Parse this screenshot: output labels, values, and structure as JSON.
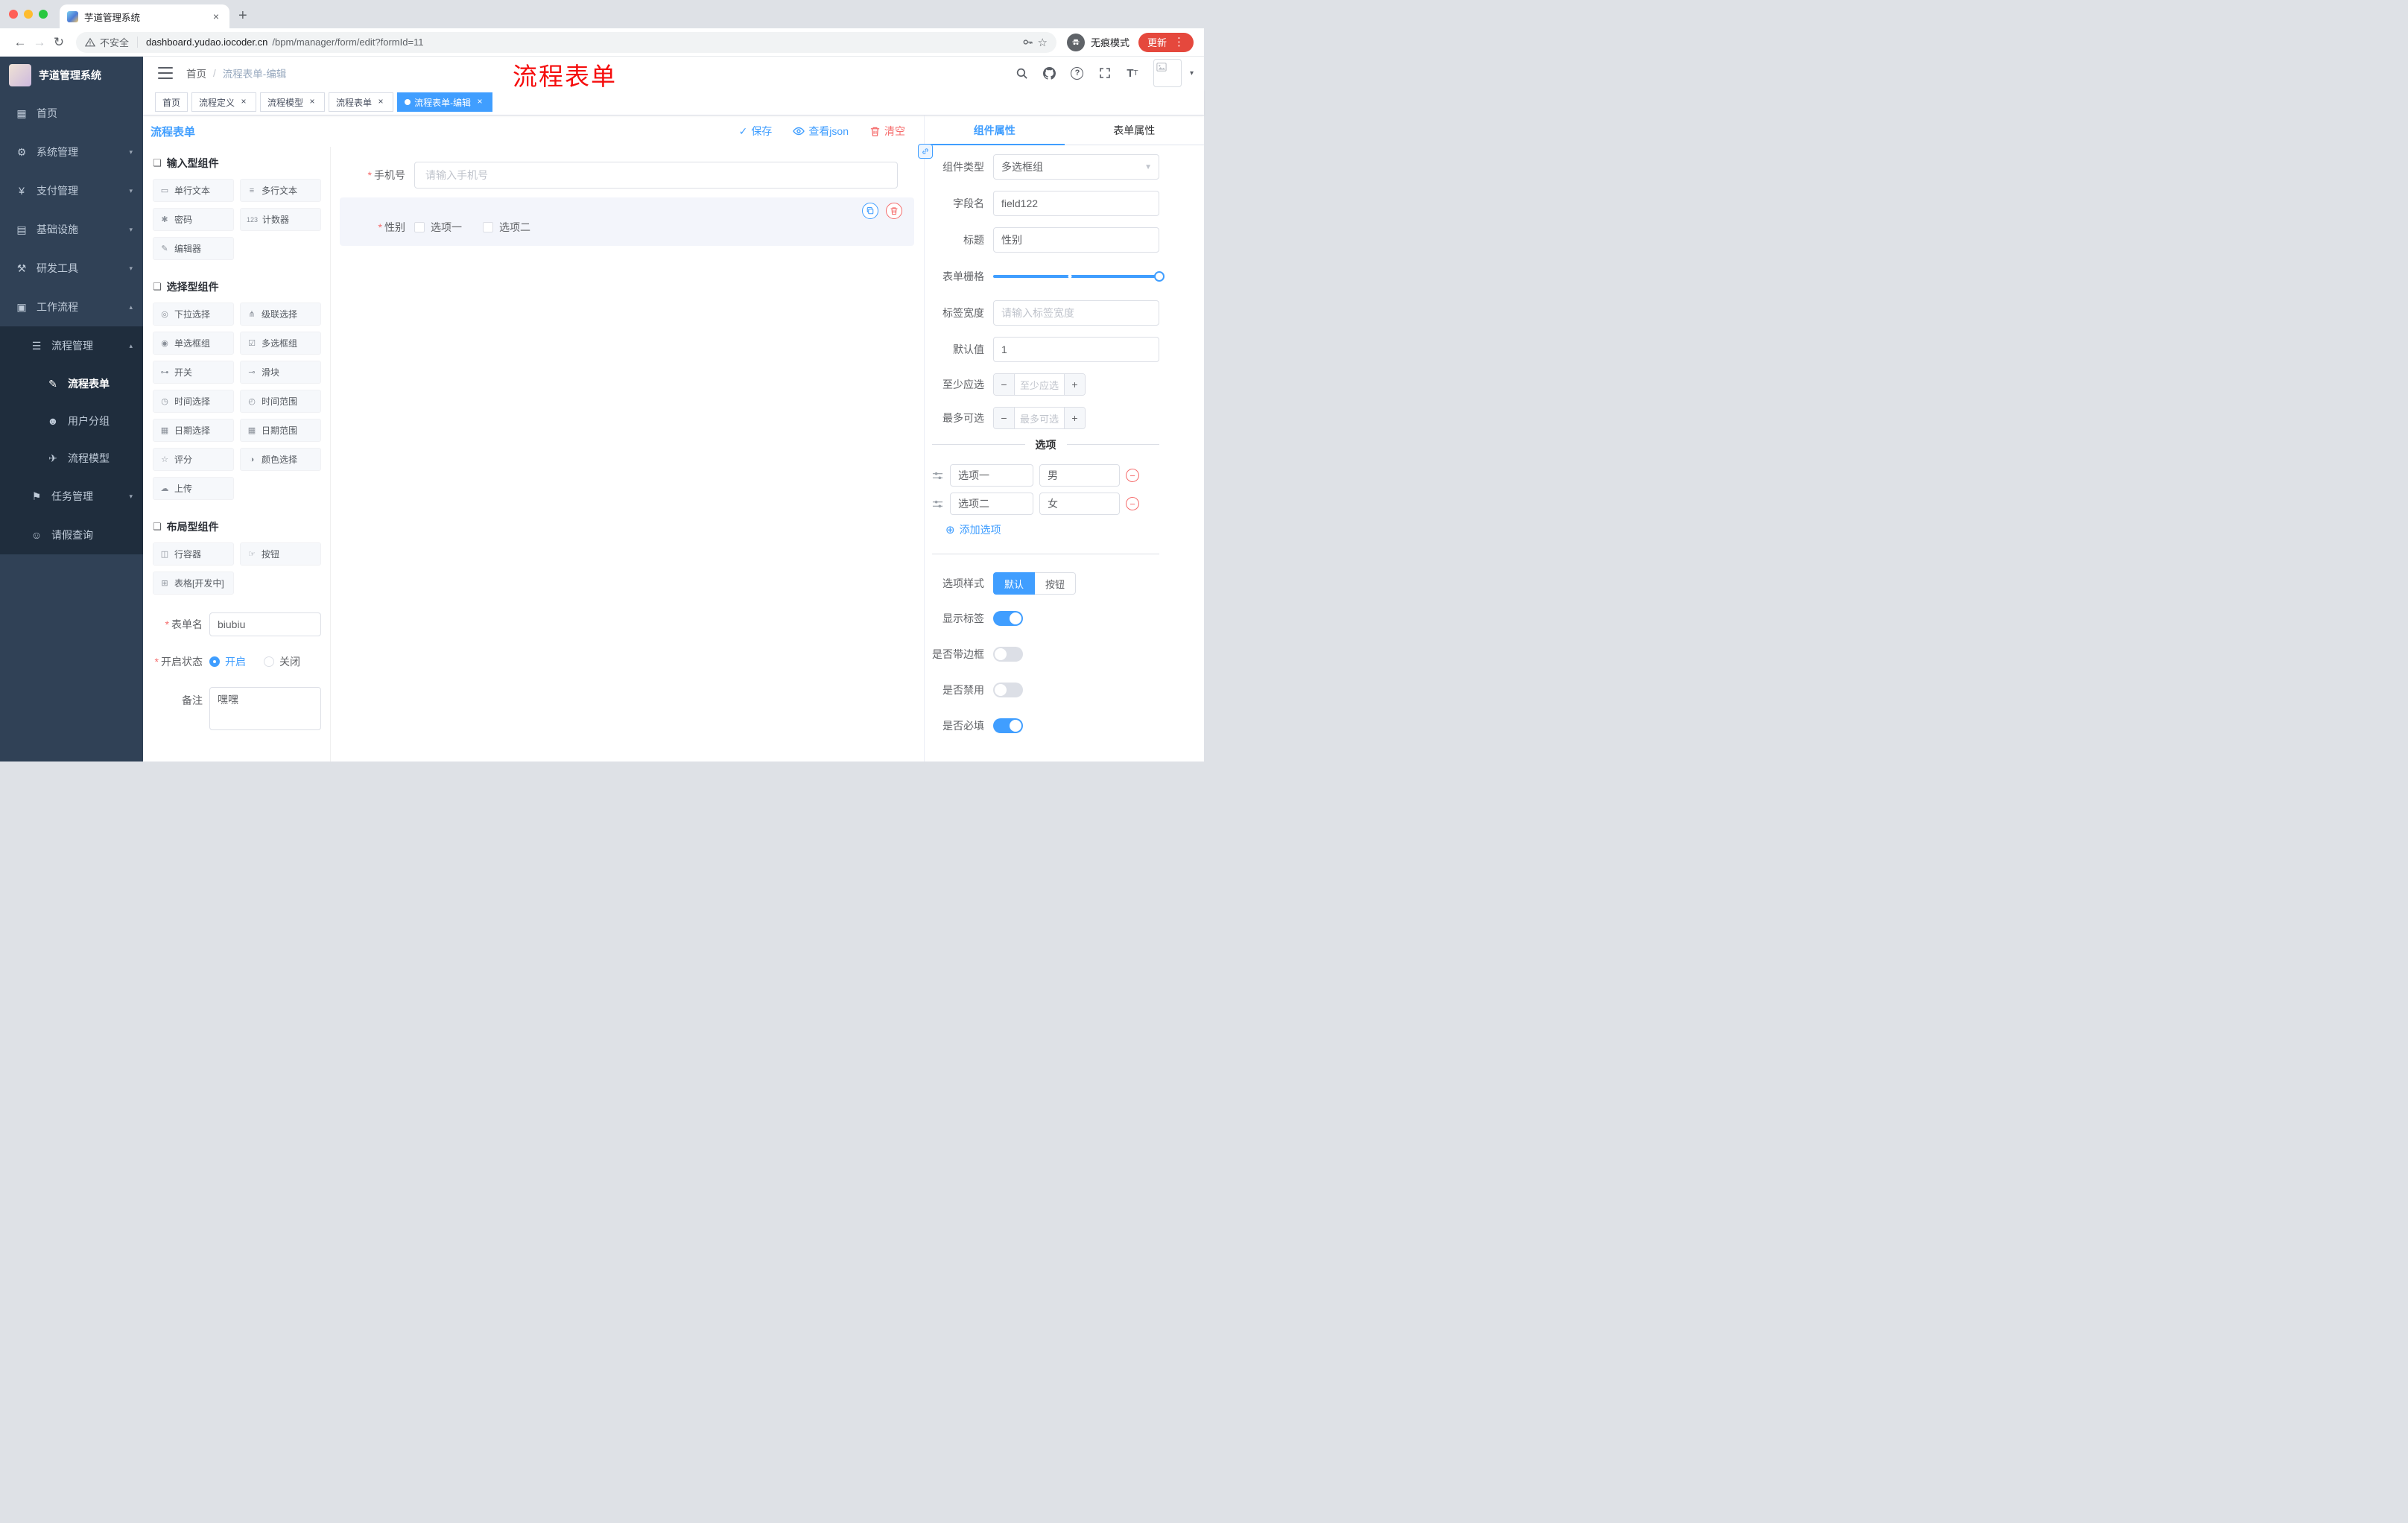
{
  "colors": {
    "primary": "#409eff",
    "danger": "#f56c6c",
    "sidebar_bg": "#304156",
    "submenu_bg": "#1f2d3d",
    "update_chip": "#e5483d",
    "annotation_red": "#f50d0d"
  },
  "browser": {
    "tab_title": "芋道管理系统",
    "security_label": "不安全",
    "url_host": "dashboard.yudao.iocoder.cn",
    "url_path": "/bpm/manager/form/edit?formId=11",
    "incognito_label": "无痕模式",
    "update_label": "更新"
  },
  "annotation": "流程表单",
  "sidebar": {
    "logo_title": "芋道管理系统",
    "menu": [
      {
        "label": "首页",
        "icon": "▦"
      },
      {
        "label": "系统管理",
        "icon": "⚙"
      },
      {
        "label": "支付管理",
        "icon": "¥"
      },
      {
        "label": "基础设施",
        "icon": "▤"
      },
      {
        "label": "研发工具",
        "icon": "⚒"
      },
      {
        "label": "工作流程",
        "icon": "▣"
      },
      {
        "label": "流程管理",
        "icon": "☰"
      },
      {
        "label": "流程表单",
        "icon": "✎"
      },
      {
        "label": "用户分组",
        "icon": "☻"
      },
      {
        "label": "流程模型",
        "icon": "✈"
      },
      {
        "label": "任务管理",
        "icon": "⚑"
      },
      {
        "label": "请假查询",
        "icon": "☺"
      }
    ]
  },
  "header": {
    "breadcrumb": {
      "home": "首页",
      "sep": "/",
      "current": "流程表单-编辑"
    }
  },
  "tags": [
    {
      "label": "首页",
      "closable": false,
      "active": false
    },
    {
      "label": "流程定义",
      "closable": true,
      "active": false
    },
    {
      "label": "流程模型",
      "closable": true,
      "active": false
    },
    {
      "label": "流程表单",
      "closable": true,
      "active": false
    },
    {
      "label": "流程表单-编辑",
      "closable": true,
      "active": true
    }
  ],
  "designer": {
    "title": "流程表单",
    "actions": {
      "save": "保存",
      "view_json": "查看json",
      "clear": "清空"
    },
    "palette": {
      "sections": [
        {
          "title": "输入型组件",
          "icon": "❏",
          "items": [
            {
              "label": "单行文本",
              "icon": "▭"
            },
            {
              "label": "多行文本",
              "icon": "≡"
            },
            {
              "label": "密码",
              "icon": "✱"
            },
            {
              "label": "计数器",
              "icon": "123"
            },
            {
              "label": "编辑器",
              "icon": "✎"
            }
          ]
        },
        {
          "title": "选择型组件",
          "icon": "❏",
          "items": [
            {
              "label": "下拉选择",
              "icon": "◎"
            },
            {
              "label": "级联选择",
              "icon": "⋔"
            },
            {
              "label": "单选框组",
              "icon": "◉"
            },
            {
              "label": "多选框组",
              "icon": "☑"
            },
            {
              "label": "开关",
              "icon": "⊶"
            },
            {
              "label": "滑块",
              "icon": "⊸"
            },
            {
              "label": "时间选择",
              "icon": "◷"
            },
            {
              "label": "时间范围",
              "icon": "◴"
            },
            {
              "label": "日期选择",
              "icon": "▦"
            },
            {
              "label": "日期范围",
              "icon": "▦"
            },
            {
              "label": "评分",
              "icon": "☆"
            },
            {
              "label": "颜色选择",
              "icon": "◑"
            },
            {
              "label": "上传",
              "icon": "☁"
            }
          ]
        },
        {
          "title": "布局型组件",
          "icon": "❏",
          "items": [
            {
              "label": "行容器",
              "icon": "◫"
            },
            {
              "label": "按钮",
              "icon": "☞"
            },
            {
              "label": "表格[开发中]",
              "icon": "⊞"
            }
          ]
        }
      ]
    },
    "meta": {
      "name_label": "表单名",
      "name_value": "biubiu",
      "status_label": "开启状态",
      "status_on": "开启",
      "status_off": "关闭",
      "status_selected": "开启",
      "remark_label": "备注",
      "remark_value": "嘿嘿"
    },
    "canvas": {
      "phone_label": "手机号",
      "phone_placeholder": "请输入手机号",
      "gender_label": "性别",
      "gender_option1": "选项一",
      "gender_option2": "选项二"
    }
  },
  "props": {
    "tab_component": "组件属性",
    "tab_form": "表单属性",
    "component_type_label": "组件类型",
    "component_type_value": "多选框组",
    "field_name_label": "字段名",
    "field_name_value": "field122",
    "title_label": "标题",
    "title_value": "性别",
    "grid_label": "表单栅格",
    "label_width_label": "标签宽度",
    "label_width_placeholder": "请输入标签宽度",
    "default_label": "默认值",
    "default_value": "1",
    "min_label": "至少应选",
    "min_placeholder": "至少应选",
    "max_label": "最多可选",
    "max_placeholder": "最多可选",
    "options_title": "选项",
    "options": [
      {
        "label": "选项一",
        "value": "男"
      },
      {
        "label": "选项二",
        "value": "女"
      }
    ],
    "add_option": "添加选项",
    "style_label": "选项样式",
    "style_default": "默认",
    "style_button": "按钮",
    "style_selected": "默认",
    "switch_show_label": "显示标签",
    "switch_show_label_on": true,
    "switch_border": "是否带边框",
    "switch_border_on": false,
    "switch_disabled": "是否禁用",
    "switch_disabled_on": false,
    "switch_required": "是否必填",
    "switch_required_on": true
  }
}
